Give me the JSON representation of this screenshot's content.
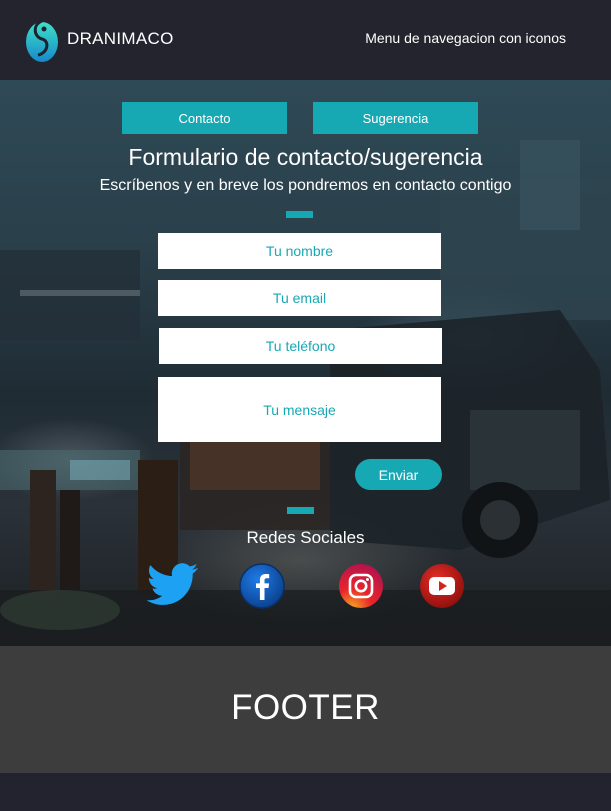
{
  "header": {
    "brand": "DRANIMACO",
    "nav_text": "Menu de navegacion con iconos"
  },
  "tabs": [
    {
      "label": "Contacto"
    },
    {
      "label": "Sugerencia"
    }
  ],
  "form": {
    "title": "Formulario de contacto/sugerencia",
    "subtitle": "Escríbenos y en breve los pondremos en contacto contigo",
    "fields": {
      "name": "Tu nombre",
      "email": "Tu email",
      "phone": "Tu teléfono",
      "message": "Tu mensaje"
    },
    "submit_label": "Enviar"
  },
  "social": {
    "title": "Redes Sociales",
    "icons": [
      "twitter-icon",
      "facebook-icon",
      "instagram-icon",
      "youtube-icon"
    ]
  },
  "footer": {
    "text": "FOOTER"
  },
  "colors": {
    "accent": "#17a9b3",
    "header_bg": "#24242f",
    "footer_bg": "#3d3d3d"
  }
}
